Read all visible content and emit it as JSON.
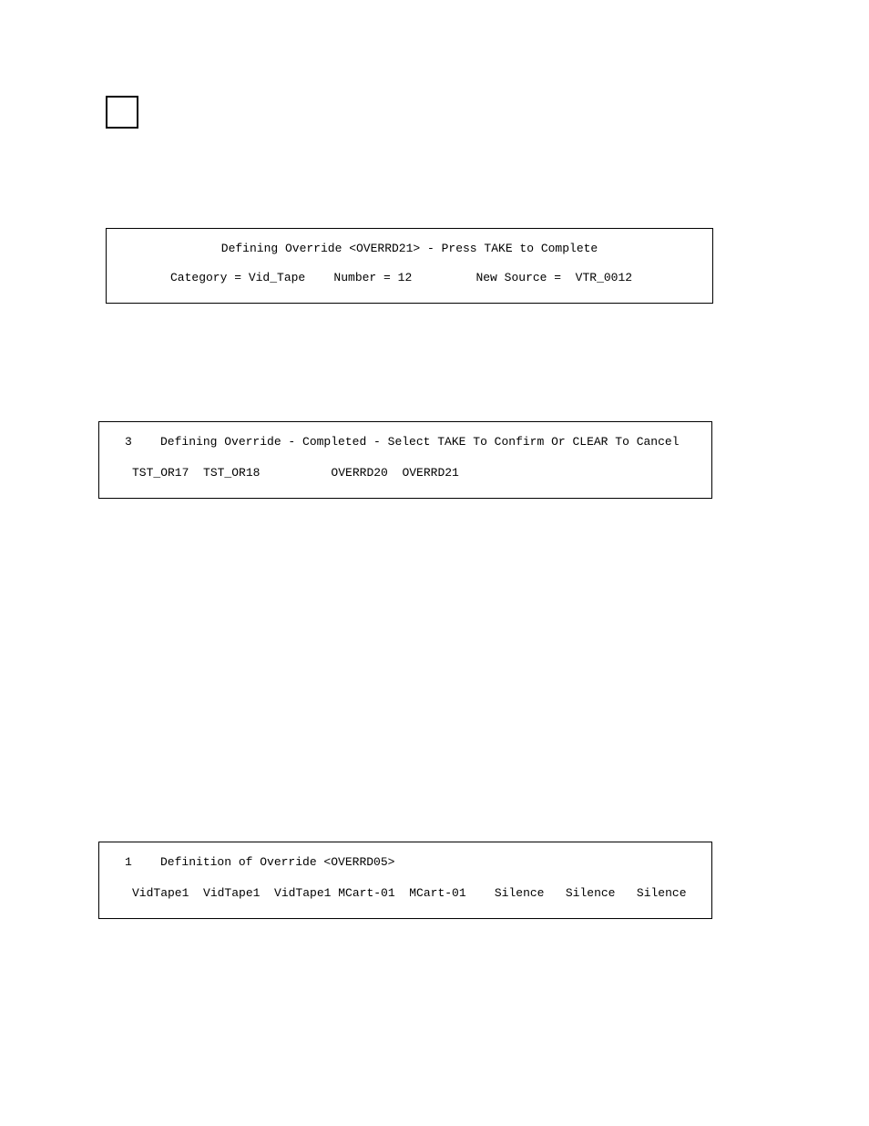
{
  "panel1": {
    "line1": "Defining Override <OVERRD21> - Press TAKE to Complete",
    "line2": "Category = Vid_Tape    Number = 12         New Source =  VTR_0012"
  },
  "panel2": {
    "line1": "3    Defining Override - Completed - Select TAKE To Confirm Or CLEAR To Cancel",
    "line2": "TST_OR17  TST_OR18          OVERRD20  OVERRD21"
  },
  "panel3": {
    "line1": "1    Definition of Override <OVERRD05>",
    "line2": "VidTape1  VidTape1  VidTape1 MCart-01  MCart-01    Silence   Silence   Silence"
  }
}
